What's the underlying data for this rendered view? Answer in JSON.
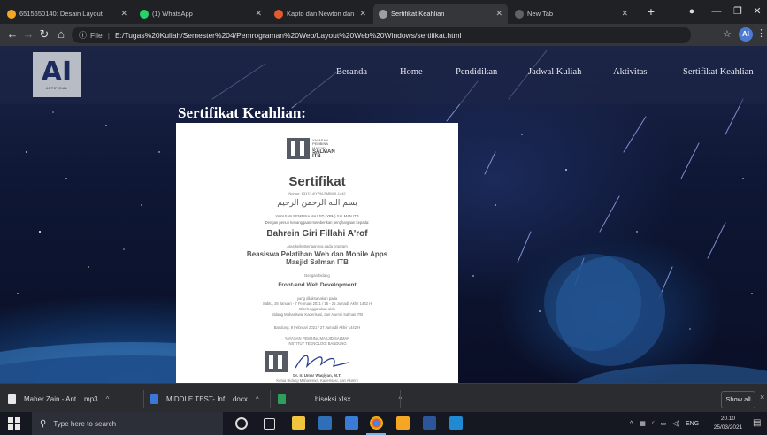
{
  "browser": {
    "tabs": [
      {
        "title": "6515650140: Desain Layout",
        "icon": "tab-favicon",
        "color": "#f5a623"
      },
      {
        "title": "(1) WhatsApp",
        "icon": "whatsapp-icon",
        "color": "#25d366"
      },
      {
        "title": "Kapto dan Newton dan Raptor",
        "icon": "tab-favicon",
        "color": "#e55a2b"
      },
      {
        "title": "Sertifikat Keahlian",
        "icon": "globe-icon",
        "color": "#9aa0a6"
      },
      {
        "title": "New Tab",
        "icon": "tab-favicon",
        "color": "#9aa0a6"
      }
    ],
    "new_tab": "+",
    "address": {
      "info": "ⓘ",
      "scheme": "File",
      "url": "E:/Tugas%20Kuliah/Semester%204/Pemrograman%20Web/Layout%20Web%20Windows/sertifikat.html"
    },
    "profile_initials": "AI"
  },
  "site": {
    "logo_text": "AI",
    "logo_sub": "ARTIFICIAL",
    "nav": [
      "Beranda",
      "Home",
      "Pendidikan",
      "Jadwal Kuliah",
      "Aktivitas",
      "Sertifikat Keahlian"
    ],
    "heading": "Sertifikat Keahlian:"
  },
  "certificate": {
    "org_logo_lines": [
      "YAYASAN",
      "PEMBINA",
      "MASJID"
    ],
    "org_logo_name": "SALMAN",
    "org_logo_sub": "ITB",
    "title": "Sertifikat",
    "number": "Nomor: 1317/I.4/YPM-SMB/I/II-1442",
    "arabic": "بسم الله الرحمن الرحيم",
    "foundation": "YAYASAN PEMBINA MASJID (YPM) SALMAN ITB",
    "intro": "Dengan penuh kebanggaan memberikan penghargaan kepada:",
    "recipient": "Bahrein Giri Fillahi A'rof",
    "participation": "Atas keikutsertaannya pada program",
    "program_line1": "Beasiswa Pelatihan Web dan Mobile Apps",
    "program_line2": "Masjid Salman ITB",
    "field_intro": "Dengan bidang",
    "field": "Front-end Web Development",
    "held": "yang dilaksanakan pada",
    "dates": "Sabtu, 26 Januari - 7 Februari 2021 / 15 - 25 Jumadil Akhir 1442 H",
    "organizer_intro": "Diselenggarakan oleh",
    "organizer": "Bidang Mahasiswa, Kaderisasi, dan Alumni Salman ITB",
    "place_date": "Bandung, 9 Februari 2021 / 27 Jumadil Akhir 1442 H",
    "sign_org1": "YAYASAN PEMBINA MASJID SALMAN",
    "sign_org2": "INSTITUT TEKNOLOGI BANDUNG",
    "signatory": "Dr. Ir. Umar Waqiyan, M.T.",
    "signatory_title": "Ketua Bidang Mahasiswa, Kaderisasi, dan Alumni"
  },
  "downloads": {
    "items": [
      {
        "name": "Maher Zain - Ant....mp3",
        "icon": "audio-file-icon",
        "color": "#e8e8e8"
      },
      {
        "name": "MIDDLE TEST- Inf....docx",
        "icon": "word-file-icon",
        "color": "#3b77d8"
      },
      {
        "name": "biseksi.xlsx",
        "icon": "excel-file-icon",
        "color": "#2e9e5b"
      }
    ],
    "show_all": "Show all",
    "close": "×"
  },
  "taskbar": {
    "search_placeholder": "Type here to search",
    "tray_lang": "ENG",
    "time": "20.10",
    "date": "25/03/2021"
  }
}
